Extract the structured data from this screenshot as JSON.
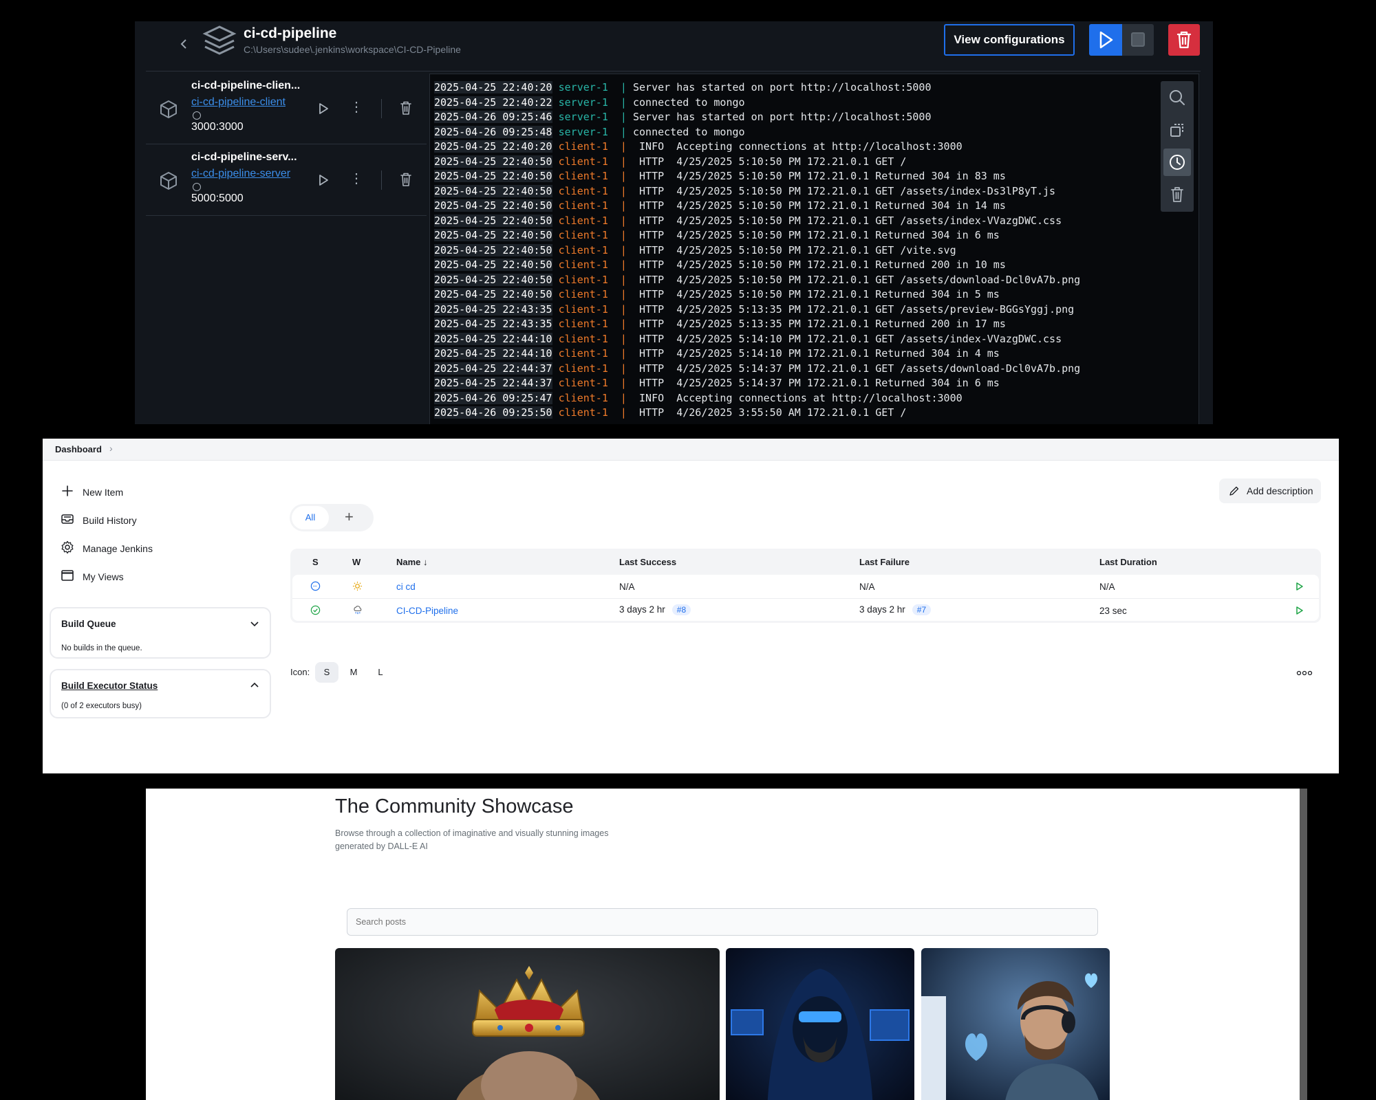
{
  "docker": {
    "project_title": "ci-cd-pipeline",
    "project_path": "C:\\Users\\sudee\\.jenkins\\workspace\\CI-CD-Pipeline",
    "view_config_label": "View configurations",
    "containers": [
      {
        "name": "ci-cd-pipeline-clien...",
        "link": "ci-cd-pipeline-client",
        "ports": "3000:3000"
      },
      {
        "name": "ci-cd-pipeline-serv...",
        "link": "ci-cd-pipeline-server",
        "ports": "5000:5000"
      }
    ],
    "colors": {
      "accent": "#1f6feb",
      "danger": "#d62f3e",
      "server": "#28b5a7",
      "client": "#f07b2a"
    },
    "log_lines": [
      {
        "ts": "2025-04-25 22:40:20",
        "svc": "server-1",
        "msg": "Server has started on port http://localhost:5000"
      },
      {
        "ts": "2025-04-25 22:40:22",
        "svc": "server-1",
        "msg": "connected to mongo"
      },
      {
        "ts": "2025-04-26 09:25:46",
        "svc": "server-1",
        "msg": "Server has started on port http://localhost:5000"
      },
      {
        "ts": "2025-04-26 09:25:48",
        "svc": "server-1",
        "msg": "connected to mongo"
      },
      {
        "ts": "2025-04-25 22:40:20",
        "svc": "client-1",
        "msg": " INFO  Accepting connections at http://localhost:3000"
      },
      {
        "ts": "2025-04-25 22:40:50",
        "svc": "client-1",
        "msg": " HTTP  4/25/2025 5:10:50 PM 172.21.0.1 GET /"
      },
      {
        "ts": "2025-04-25 22:40:50",
        "svc": "client-1",
        "msg": " HTTP  4/25/2025 5:10:50 PM 172.21.0.1 Returned 304 in 83 ms"
      },
      {
        "ts": "2025-04-25 22:40:50",
        "svc": "client-1",
        "msg": " HTTP  4/25/2025 5:10:50 PM 172.21.0.1 GET /assets/index-Ds3lP8yT.js"
      },
      {
        "ts": "2025-04-25 22:40:50",
        "svc": "client-1",
        "msg": " HTTP  4/25/2025 5:10:50 PM 172.21.0.1 Returned 304 in 14 ms"
      },
      {
        "ts": "2025-04-25 22:40:50",
        "svc": "client-1",
        "msg": " HTTP  4/25/2025 5:10:50 PM 172.21.0.1 GET /assets/index-VVazgDWC.css"
      },
      {
        "ts": "2025-04-25 22:40:50",
        "svc": "client-1",
        "msg": " HTTP  4/25/2025 5:10:50 PM 172.21.0.1 Returned 304 in 6 ms"
      },
      {
        "ts": "2025-04-25 22:40:50",
        "svc": "client-1",
        "msg": " HTTP  4/25/2025 5:10:50 PM 172.21.0.1 GET /vite.svg"
      },
      {
        "ts": "2025-04-25 22:40:50",
        "svc": "client-1",
        "msg": " HTTP  4/25/2025 5:10:50 PM 172.21.0.1 Returned 200 in 10 ms"
      },
      {
        "ts": "2025-04-25 22:40:50",
        "svc": "client-1",
        "msg": " HTTP  4/25/2025 5:10:50 PM 172.21.0.1 GET /assets/download-Dcl0vA7b.png"
      },
      {
        "ts": "2025-04-25 22:40:50",
        "svc": "client-1",
        "msg": " HTTP  4/25/2025 5:10:50 PM 172.21.0.1 Returned 304 in 5 ms"
      },
      {
        "ts": "2025-04-25 22:43:35",
        "svc": "client-1",
        "msg": " HTTP  4/25/2025 5:13:35 PM 172.21.0.1 GET /assets/preview-BGGsYggj.png"
      },
      {
        "ts": "2025-04-25 22:43:35",
        "svc": "client-1",
        "msg": " HTTP  4/25/2025 5:13:35 PM 172.21.0.1 Returned 200 in 17 ms"
      },
      {
        "ts": "2025-04-25 22:44:10",
        "svc": "client-1",
        "msg": " HTTP  4/25/2025 5:14:10 PM 172.21.0.1 GET /assets/index-VVazgDWC.css"
      },
      {
        "ts": "2025-04-25 22:44:10",
        "svc": "client-1",
        "msg": " HTTP  4/25/2025 5:14:10 PM 172.21.0.1 Returned 304 in 4 ms"
      },
      {
        "ts": "2025-04-25 22:44:37",
        "svc": "client-1",
        "msg": " HTTP  4/25/2025 5:14:37 PM 172.21.0.1 GET /assets/download-Dcl0vA7b.png"
      },
      {
        "ts": "2025-04-25 22:44:37",
        "svc": "client-1",
        "msg": " HTTP  4/25/2025 5:14:37 PM 172.21.0.1 Returned 304 in 6 ms"
      },
      {
        "ts": "2025-04-26 09:25:47",
        "svc": "client-1",
        "msg": " INFO  Accepting connections at http://localhost:3000"
      },
      {
        "ts": "2025-04-26 09:25:50",
        "svc": "client-1",
        "msg": " HTTP  4/26/2025 3:55:50 AM 172.21.0.1 GET /"
      }
    ],
    "log_tools": [
      "search-icon",
      "copy-icon",
      "clock-icon",
      "trash-icon"
    ]
  },
  "jenkins": {
    "breadcrumb": "Dashboard",
    "sidebar": [
      {
        "label": "New Item",
        "icon": "plus-icon"
      },
      {
        "label": "Build History",
        "icon": "inbox-icon"
      },
      {
        "label": "Manage Jenkins",
        "icon": "gear-icon"
      },
      {
        "label": "My Views",
        "icon": "window-icon"
      }
    ],
    "build_queue": {
      "title": "Build Queue",
      "status": "No builds in the queue."
    },
    "executor_status": {
      "title": "Build Executor Status",
      "status": "(0 of 2 executors busy)"
    },
    "add_description": "Add description",
    "tabs": {
      "all": "All",
      "plus": "+"
    },
    "columns": {
      "s": "S",
      "w": "W",
      "name": "Name ↓",
      "last_success": "Last Success",
      "last_failure": "Last Failure",
      "last_duration": "Last Duration"
    },
    "jobs": [
      {
        "name": "ci cd",
        "last_success": "N/A",
        "success_build": "",
        "last_failure": "N/A",
        "failure_build": "",
        "last_duration": "N/A",
        "status": "not-built",
        "weather": "sunny"
      },
      {
        "name": "CI-CD-Pipeline",
        "last_success": "3 days 2 hr",
        "success_build": "#8",
        "last_failure": "3 days 2 hr",
        "failure_build": "#7",
        "last_duration": "23 sec",
        "status": "success",
        "weather": "cloudy-rain"
      }
    ],
    "icon_size": {
      "label": "Icon:",
      "options": [
        "S",
        "M",
        "L"
      ],
      "selected": "S"
    }
  },
  "showcase": {
    "title": "The Community Showcase",
    "subtitle": "Browse through a collection of imaginative and visually stunning images generated by DALL-E AI",
    "search_placeholder": "Search posts",
    "images": [
      "crowned-hamster-image",
      "hooded-hacker-image",
      "headphones-man-image"
    ]
  }
}
